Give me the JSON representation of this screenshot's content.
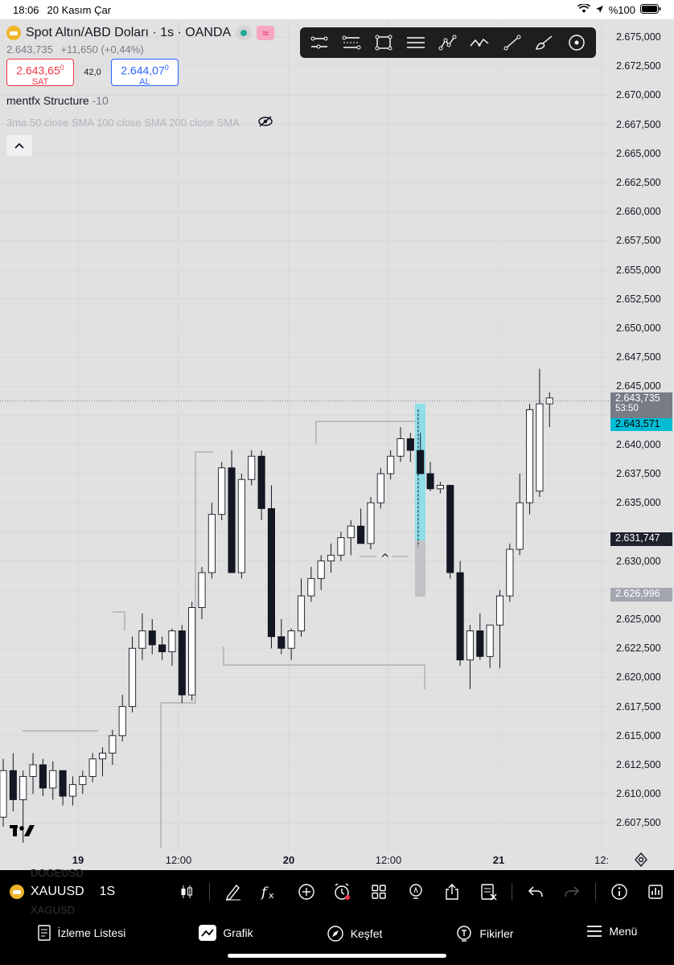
{
  "status_bar": {
    "time": "18:06",
    "date": "20 Kasım Çar",
    "battery": "%100"
  },
  "legend": {
    "title": "Spot Altın/ABD Doları · 1s · OANDA",
    "price": "2.643,735",
    "change": "+11,650 (+0,44%)",
    "sell": {
      "value": "2.643,65",
      "sup": "0",
      "label": "SAT"
    },
    "spread": "42,0",
    "buy": {
      "value": "2.644,07",
      "sup": "0",
      "label": "AL"
    },
    "indicator1_name": "mentfx Structure",
    "indicator1_value": "-10",
    "indicator2": "3ma 50 close SMA 100 close SMA 200 close SMA",
    "delay_badge": "≈"
  },
  "price_axis": {
    "labels": [
      "2.675,000",
      "2.672,500",
      "2.670,000",
      "2.667,500",
      "2.665,000",
      "2.662,500",
      "2.660,000",
      "2.657,500",
      "2.655,000",
      "2.652,500",
      "2.650,000",
      "2.647,500",
      "2.645,000",
      "2.640,000",
      "2.637,500",
      "2.635,000",
      "2.630,000",
      "2.625,000",
      "2.622,500",
      "2.620,000",
      "2.617,500",
      "2.615,000",
      "2.612,500",
      "2.610,000",
      "2.607,500"
    ],
    "current_price": "2.643,735",
    "countdown": "53:50",
    "cyan_tag": "2.643,571",
    "dark_tag": "2.631,747",
    "gray_tag": "2.626,996"
  },
  "time_axis": [
    {
      "label": "19",
      "bold": true
    },
    {
      "label": "12:00",
      "bold": false
    },
    {
      "label": "20",
      "bold": true
    },
    {
      "label": "12:00",
      "bold": false
    },
    {
      "label": "21",
      "bold": true
    },
    {
      "label": "12:",
      "bold": false
    }
  ],
  "bottom_toolbar": {
    "symbol": "XAUUSD",
    "interval": "1S",
    "ghost_above": "DOGEUSD",
    "ghost_below": "XAGUSD"
  },
  "bottom_nav": [
    {
      "label": "İzleme Listesi",
      "icon": "watchlist-icon"
    },
    {
      "label": "Grafik",
      "icon": "chart-icon",
      "active": true
    },
    {
      "label": "Keşfet",
      "icon": "compass-icon"
    },
    {
      "label": "Fikirler",
      "icon": "ideas-icon"
    },
    {
      "label": "Menü",
      "icon": "menu-icon"
    }
  ],
  "colors": {
    "bg": "#e1e1e1",
    "bull": "#ffffff",
    "bear": "#131722",
    "cyan": "#26c6da",
    "sell": "#f23645",
    "buy": "#2962ff"
  },
  "chart_data": {
    "type": "candlestick",
    "symbol": "XAUUSD",
    "interval": "1h",
    "ylim": [
      2605.8,
      2677.2
    ],
    "candles": [
      [
        2608.0,
        2613.0,
        2607.2,
        2612.0
      ],
      [
        2612.0,
        2613.5,
        2608.5,
        2609.5
      ],
      [
        2609.5,
        2612.0,
        2605.8,
        2611.5
      ],
      [
        2611.5,
        2613.5,
        2610.0,
        2612.5
      ],
      [
        2612.5,
        2613.0,
        2609.8,
        2610.5
      ],
      [
        2610.5,
        2612.8,
        2609.5,
        2612.0
      ],
      [
        2612.0,
        2611.0,
        2609.0,
        2609.8
      ],
      [
        2609.8,
        2611.5,
        2609.0,
        2610.8
      ],
      [
        2610.8,
        2612.0,
        2610.0,
        2611.5
      ],
      [
        2611.5,
        2613.5,
        2611.0,
        2613.0
      ],
      [
        2613.0,
        2614.0,
        2611.5,
        2613.5
      ],
      [
        2613.5,
        2615.5,
        2612.5,
        2615.0
      ],
      [
        2615.0,
        2618.5,
        2614.5,
        2617.5
      ],
      [
        2617.5,
        2623.5,
        2617.0,
        2622.5
      ],
      [
        2622.5,
        2625.5,
        2621.5,
        2624.0
      ],
      [
        2624.0,
        2625.0,
        2622.0,
        2622.8
      ],
      [
        2622.8,
        2623.5,
        2621.5,
        2622.2
      ],
      [
        2622.2,
        2624.2,
        2621.0,
        2624.0
      ],
      [
        2624.0,
        2624.5,
        2617.8,
        2618.5
      ],
      [
        2618.5,
        2626.5,
        2618.0,
        2626.0
      ],
      [
        2626.0,
        2629.5,
        2625.0,
        2629.0
      ],
      [
        2629.0,
        2635.0,
        2628.5,
        2634.0
      ],
      [
        2634.0,
        2638.5,
        2633.5,
        2638.0
      ],
      [
        2638.0,
        2639.5,
        2629.0,
        2629.0
      ],
      [
        2629.0,
        2637.5,
        2628.5,
        2637.0
      ],
      [
        2637.0,
        2639.5,
        2636.5,
        2639.0
      ],
      [
        2639.0,
        2639.5,
        2633.5,
        2634.5
      ],
      [
        2634.5,
        2636.5,
        2622.5,
        2623.5
      ],
      [
        2623.5,
        2625.0,
        2622.0,
        2622.5
      ],
      [
        2622.5,
        2624.2,
        2621.5,
        2624.0
      ],
      [
        2624.0,
        2628.5,
        2623.5,
        2627.0
      ],
      [
        2627.0,
        2629.5,
        2626.5,
        2628.5
      ],
      [
        2628.5,
        2630.5,
        2627.5,
        2630.0
      ],
      [
        2630.0,
        2631.5,
        2629.0,
        2630.5
      ],
      [
        2630.5,
        2632.5,
        2630.0,
        2632.0
      ],
      [
        2632.0,
        2633.5,
        2630.5,
        2633.0
      ],
      [
        2633.0,
        2634.5,
        2632.5,
        2631.5
      ],
      [
        2631.5,
        2635.5,
        2631.0,
        2635.0
      ],
      [
        2635.0,
        2638.0,
        2634.5,
        2637.5
      ],
      [
        2637.5,
        2639.5,
        2637.0,
        2639.0
      ],
      [
        2639.0,
        2641.5,
        2638.5,
        2640.5
      ],
      [
        2640.5,
        2641.0,
        2638.5,
        2639.5
      ],
      [
        2639.5,
        2641.0,
        2637.8,
        2637.5
      ],
      [
        2637.5,
        2638.5,
        2636.0,
        2636.2
      ],
      [
        2636.2,
        2636.8,
        2635.8,
        2636.5
      ],
      [
        2636.5,
        2636.5,
        2628.5,
        2629.0
      ],
      [
        2629.0,
        2630.0,
        2621.0,
        2621.5
      ],
      [
        2621.5,
        2624.5,
        2619.0,
        2624.0
      ],
      [
        2624.0,
        2625.5,
        2621.5,
        2621.8
      ],
      [
        2621.8,
        2624.5,
        2620.8,
        2624.5
      ],
      [
        2624.5,
        2627.5,
        2620.8,
        2627.0
      ],
      [
        2627.0,
        2631.5,
        2626.5,
        2631.0
      ],
      [
        2631.0,
        2637.5,
        2630.5,
        2635.0
      ],
      [
        2635.0,
        2643.5,
        2634.0,
        2643.0
      ],
      [
        2636.0,
        2646.5,
        2635.5,
        2643.5
      ],
      [
        2643.5,
        2644.5,
        2641.5,
        2644.0
      ]
    ],
    "current_price": 2643.735
  }
}
